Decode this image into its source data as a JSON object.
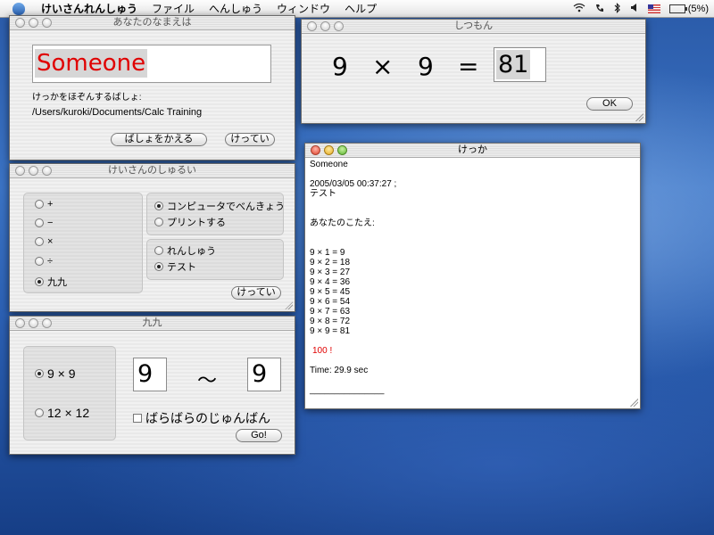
{
  "menubar": {
    "app_name": "けいさんれんしゅう",
    "items": [
      "ファイル",
      "へんしゅう",
      "ウィンドウ",
      "ヘルプ"
    ],
    "battery_text": "(5%)"
  },
  "name_window": {
    "title": "あなたのなまえは",
    "name_value": "Someone",
    "save_location_label": "けっかをほぞんするばしょ:",
    "save_path": "/Users/kuroki/Documents/Calc Training",
    "change_location_button": "ばしょをかえる",
    "confirm_button": "けってい"
  },
  "type_window": {
    "title": "けいさんのしゅるい",
    "operations": [
      {
        "label": "+",
        "selected": false
      },
      {
        "label": "−",
        "selected": false
      },
      {
        "label": "×",
        "selected": false
      },
      {
        "label": "÷",
        "selected": false
      },
      {
        "label": "九九",
        "selected": true
      }
    ],
    "output_options": [
      {
        "label": "コンピュータでべんきょう",
        "selected": true
      },
      {
        "label": "プリントする",
        "selected": false
      }
    ],
    "mode_options": [
      {
        "label": "れんしゅう",
        "selected": false
      },
      {
        "label": "テスト",
        "selected": true
      }
    ],
    "confirm_button": "けってい"
  },
  "kuku_window": {
    "title": "九九",
    "range_options": [
      {
        "label": "9 × 9",
        "selected": true
      },
      {
        "label": "12 × 12",
        "selected": false
      }
    ],
    "from_value": "9",
    "tilde": "〜",
    "to_value": "9",
    "random_order_label": "ばらばらのじゅんばん",
    "random_order_checked": false,
    "go_button": "Go!"
  },
  "question_window": {
    "title": "しつもん",
    "operand1": "9",
    "operator": "×",
    "operand2": "9",
    "equals": "=",
    "answer": "81",
    "ok_button": "OK"
  },
  "result_window": {
    "title": "けっか",
    "name": "Someone",
    "datetime": "2005/03/05 00:37:27 ;",
    "mode": "テスト",
    "answers_heading": "あなたのこたえ:",
    "answers": [
      "9 × 1 = 9",
      "9 × 2 = 18",
      "9 × 3 = 27",
      "9 × 4 = 36",
      "9 × 5 = 45",
      "9 × 6 = 54",
      "9 × 7 = 63",
      "9 × 8 = 72",
      "9 × 9 = 81"
    ],
    "score": "100 !",
    "time": "Time: 29.9 sec",
    "separator": "_______________"
  },
  "colors": {
    "name_text": "#e00000",
    "score_text": "#e00000"
  }
}
